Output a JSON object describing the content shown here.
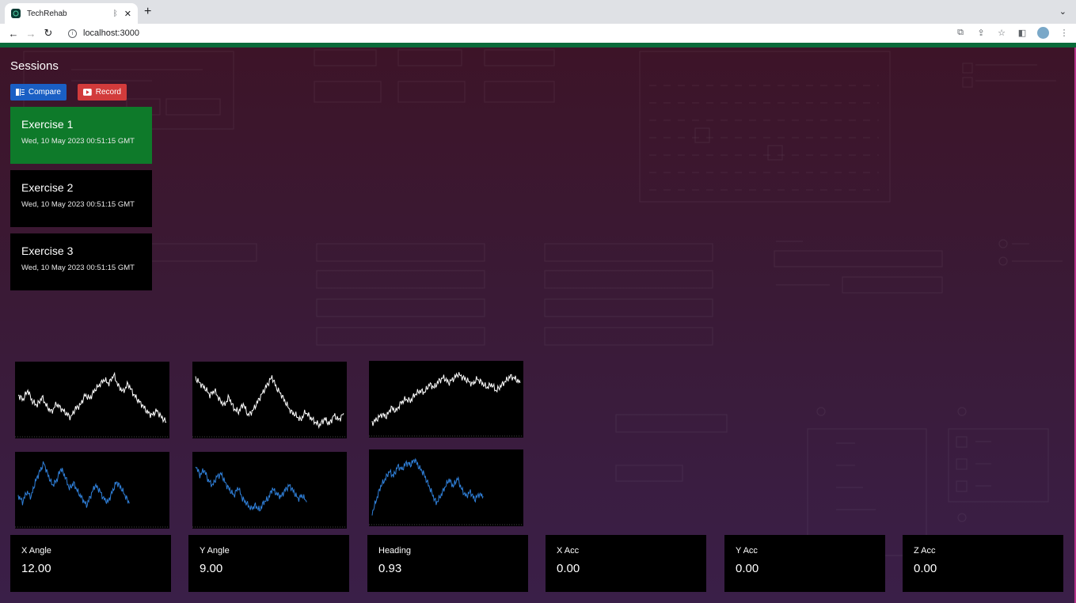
{
  "browser": {
    "tab_title": "TechRehab",
    "tab_close": "✕",
    "new_tab": "+",
    "url": "localhost:3000"
  },
  "sessions": {
    "title": "Sessions",
    "compare_label": "Compare",
    "record_label": "Record",
    "items": [
      {
        "name": "Exercise 1",
        "date": "Wed, 10 May 2023 00:51:15 GMT",
        "active": true
      },
      {
        "name": "Exercise 2",
        "date": "Wed, 10 May 2023 00:51:15 GMT",
        "active": false
      },
      {
        "name": "Exercise 3",
        "date": "Wed, 10 May 2023 00:51:15 GMT",
        "active": false
      }
    ]
  },
  "charts": {
    "trace_colors": {
      "white": "#ffffff",
      "blue": "#2f7fd8"
    },
    "traces": [
      {
        "color": "white",
        "values": [
          0.55,
          0.48,
          0.62,
          0.45,
          0.4,
          0.52,
          0.38,
          0.3,
          0.42,
          0.35,
          0.28,
          0.22,
          0.35,
          0.4,
          0.55,
          0.5,
          0.62,
          0.7,
          0.78,
          0.72,
          0.85,
          0.68,
          0.6,
          0.72,
          0.58,
          0.48,
          0.4,
          0.3,
          0.25,
          0.32,
          0.22,
          0.15
        ]
      },
      {
        "color": "white",
        "values": [
          0.8,
          0.72,
          0.65,
          0.55,
          0.62,
          0.48,
          0.4,
          0.52,
          0.35,
          0.3,
          0.42,
          0.25,
          0.32,
          0.45,
          0.58,
          0.7,
          0.82,
          0.65,
          0.55,
          0.42,
          0.3,
          0.25,
          0.18,
          0.3,
          0.22,
          0.15,
          0.1,
          0.2,
          0.12,
          0.25,
          0.18,
          0.28
        ]
      },
      {
        "color": "white",
        "values": [
          0.12,
          0.18,
          0.25,
          0.22,
          0.35,
          0.3,
          0.42,
          0.48,
          0.45,
          0.55,
          0.6,
          0.58,
          0.7,
          0.65,
          0.75,
          0.8,
          0.72,
          0.78,
          0.85,
          0.8,
          0.75,
          0.7,
          0.78,
          0.72,
          0.65,
          0.7,
          0.6,
          0.68,
          0.75,
          0.82,
          0.78,
          0.72
        ]
      },
      {
        "color": "blue",
        "values": [
          0.4,
          0.3,
          0.45,
          0.38,
          0.6,
          0.75,
          0.88,
          0.7,
          0.55,
          0.62,
          0.8,
          0.68,
          0.5,
          0.58,
          0.45,
          0.35,
          0.25,
          0.4,
          0.55,
          0.48,
          0.35,
          0.3,
          0.45,
          0.6,
          0.52,
          0.4,
          0.28
        ],
        "extent": 0.75
      },
      {
        "color": "blue",
        "values": [
          0.85,
          0.7,
          0.78,
          0.62,
          0.55,
          0.68,
          0.72,
          0.58,
          0.48,
          0.4,
          0.52,
          0.35,
          0.28,
          0.2,
          0.25,
          0.18,
          0.3,
          0.35,
          0.5,
          0.42,
          0.38,
          0.48,
          0.55,
          0.45,
          0.35,
          0.4,
          0.3
        ],
        "extent": 0.75
      },
      {
        "color": "blue",
        "values": [
          0.1,
          0.3,
          0.5,
          0.6,
          0.72,
          0.65,
          0.8,
          0.75,
          0.85,
          0.82,
          0.9,
          0.78,
          0.7,
          0.55,
          0.4,
          0.25,
          0.35,
          0.48,
          0.6,
          0.5,
          0.62,
          0.45,
          0.35,
          0.42,
          0.3,
          0.38,
          0.35
        ],
        "extent": 0.75
      }
    ]
  },
  "stats": [
    {
      "label": "X Angle",
      "value": "12.00"
    },
    {
      "label": "Y Angle",
      "value": "9.00"
    },
    {
      "label": "Heading",
      "value": "0.93"
    },
    {
      "label": "X Acc",
      "value": "0.00"
    },
    {
      "label": "Y Acc",
      "value": "0.00"
    },
    {
      "label": "Z Acc",
      "value": "0.00"
    }
  ]
}
